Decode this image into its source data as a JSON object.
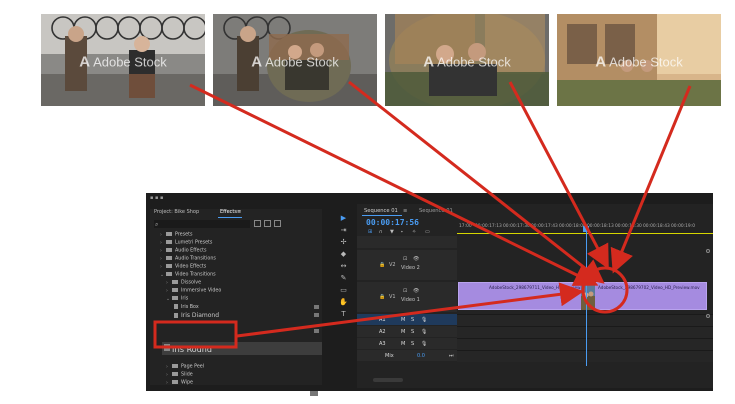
{
  "thumbnails": [
    {
      "watermark": "Adobe Stock",
      "style": "plain"
    },
    {
      "watermark": "Adobe Stock",
      "style": "iris-small"
    },
    {
      "watermark": "Adobe Stock",
      "style": "iris-large"
    },
    {
      "watermark": "Adobe Stock",
      "style": "full"
    }
  ],
  "effects_panel": {
    "tab_project": "Project: Bike Shop",
    "tab_effects": "Effects",
    "menu_icon": "≡",
    "search_icon": "⌕",
    "tree": [
      {
        "label": "Presets",
        "indent": 0
      },
      {
        "label": "Lumetri Presets",
        "indent": 0
      },
      {
        "label": "Audio Effects",
        "indent": 0
      },
      {
        "label": "Audio Transitions",
        "indent": 0
      },
      {
        "label": "Video Effects",
        "indent": 0
      },
      {
        "label": "Video Transitions",
        "indent": 0
      },
      {
        "label": "Dissolve",
        "indent": 1
      },
      {
        "label": "Immersive Video",
        "indent": 1
      },
      {
        "label": "Iris",
        "indent": 1
      },
      {
        "label": "Iris Box",
        "indent": 2
      },
      {
        "label": "Iris Diamond",
        "indent": 2
      }
    ],
    "selected_item": "Iris Round",
    "tree_after": [
      {
        "label": "Page Peel",
        "indent": 1
      },
      {
        "label": "Slide",
        "indent": 1
      },
      {
        "label": "Wipe",
        "indent": 1
      }
    ]
  },
  "timeline": {
    "tab_active": "Sequence 01",
    "tab_close": "≡",
    "tab_other": "Sequence 01",
    "timecode": "00:00:17:56",
    "ruler": [
      "17:00",
      "00:00:17:13",
      "00:00:17:30",
      "00:00:17:43",
      "00:00:18:00",
      "00:00:18:13",
      "00:00:18:30",
      "00:00:18:43",
      "00:00:19:0"
    ],
    "tracks": [
      {
        "id": "V2",
        "name": "Video 2"
      },
      {
        "id": "V1",
        "name": "Video 1"
      },
      {
        "id": "A1",
        "name": ""
      },
      {
        "id": "A2",
        "name": ""
      },
      {
        "id": "A3",
        "name": ""
      }
    ],
    "master_label": "Mix",
    "master_value": "0.0",
    "clip_a_label": "AdobeStock_298679711_Video_HD_Preview.mov",
    "clip_b_label": "AdobeStock_298679702_Video_HD_Preview.mov"
  },
  "colors": {
    "accent": "#4a9cf2",
    "annotation": "#d42a1e",
    "clip": "#a58be0"
  }
}
